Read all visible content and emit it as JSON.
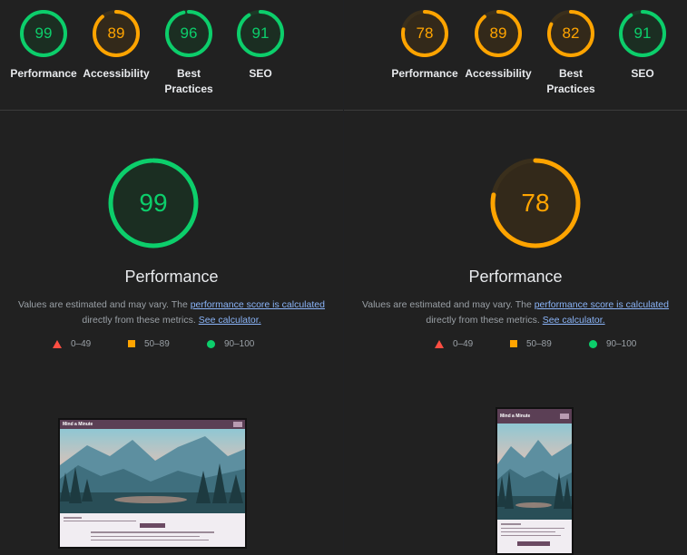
{
  "left": {
    "gauges": [
      {
        "score": "99",
        "label": "Performance",
        "status": "pass"
      },
      {
        "score": "89",
        "label": "Accessibility",
        "status": "average"
      },
      {
        "score": "96",
        "label": "Best Practices",
        "status": "pass"
      },
      {
        "score": "91",
        "label": "SEO",
        "status": "pass"
      }
    ],
    "main": {
      "score": "99",
      "title": "Performance",
      "status": "pass"
    },
    "screenshot": {
      "type": "desktop",
      "brand": "Mind a Minute"
    }
  },
  "right": {
    "gauges": [
      {
        "score": "78",
        "label": "Performance",
        "status": "average"
      },
      {
        "score": "89",
        "label": "Accessibility",
        "status": "average"
      },
      {
        "score": "82",
        "label": "Best Practices",
        "status": "average"
      },
      {
        "score": "91",
        "label": "SEO",
        "status": "pass"
      }
    ],
    "main": {
      "score": "78",
      "title": "Performance",
      "status": "average"
    },
    "screenshot": {
      "type": "mobile",
      "brand": "Mind a Minute"
    }
  },
  "description": {
    "prefix": "Values are estimated and may vary. The ",
    "link1": "performance score is calculated",
    "middle": "directly from these metrics. ",
    "link2": "See calculator."
  },
  "legend": [
    {
      "range": "0–49",
      "shape": "triangle",
      "color": "#ff4e42"
    },
    {
      "range": "50–89",
      "shape": "square",
      "color": "#ffa400"
    },
    {
      "range": "90–100",
      "shape": "circle",
      "color": "#0cce6b"
    }
  ],
  "colors": {
    "pass": "#0cce6b",
    "average": "#ffa400",
    "fail": "#ff4e42",
    "link": "#8ab4f8"
  }
}
